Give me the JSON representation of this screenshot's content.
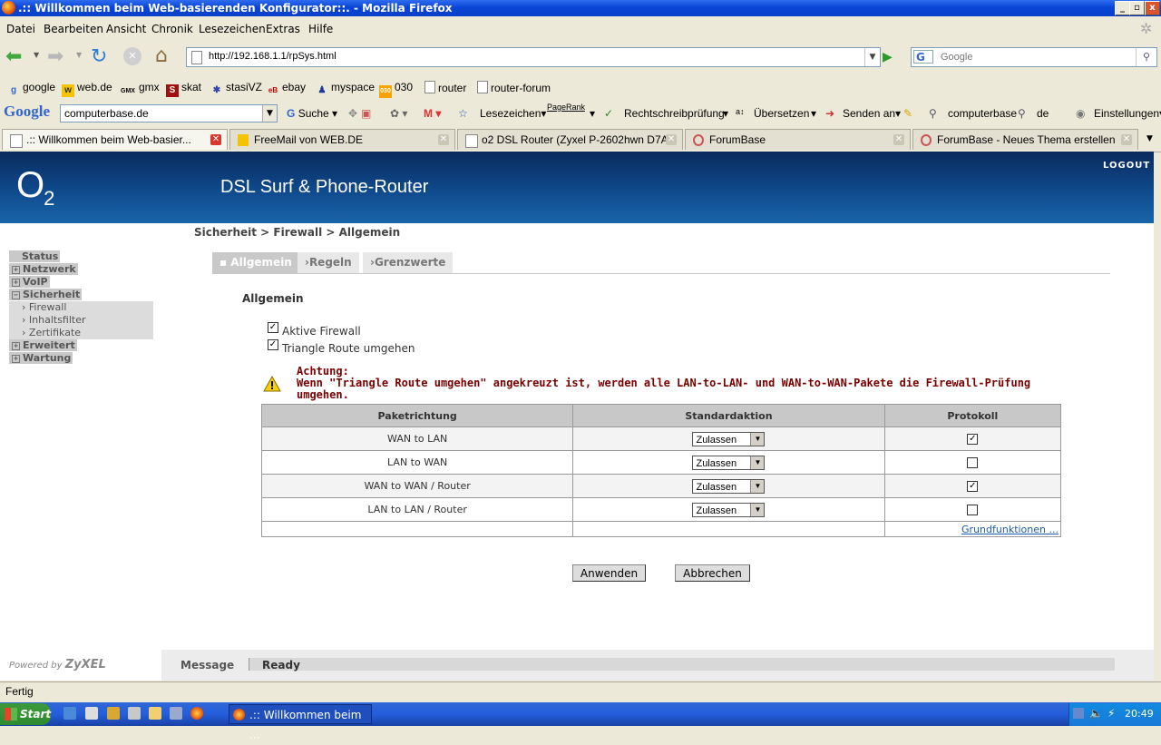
{
  "window": {
    "title": ".:: Willkommen beim Web-basierenden Konfigurator::. - Mozilla Firefox",
    "minimize": "_",
    "maximize": "▫",
    "close": "x"
  },
  "menu": [
    "Datei",
    "Bearbeiten",
    "Ansicht",
    "Chronik",
    "Lesezeichen",
    "Extras",
    "Hilfe"
  ],
  "nav": {
    "url": "http://192.168.1.1/rpSys.html",
    "search_placeholder": "Google"
  },
  "bookmarks": [
    "google",
    "web.de",
    "gmx",
    "skat",
    "stasiVZ",
    "ebay",
    "myspace",
    "030",
    "router",
    "router-forum"
  ],
  "google_toolbar": {
    "logo": "Google",
    "query": "computerbase.de",
    "suche": "Suche",
    "lesezeichen": "Lesezeichen▾",
    "pagerank": "PageRank",
    "spell": "Rechtschreibprüfung",
    "translate": "Übersetzen",
    "send": "Senden an▾",
    "term1": "computerbase",
    "term2": "de",
    "settings": "Einstellungen▾"
  },
  "tabs": [
    {
      "label": ".:: Willkommen beim Web-basier...",
      "active": true
    },
    {
      "label": "FreeMail von WEB.DE",
      "active": false
    },
    {
      "label": "o2 DSL Router (Zyxel P-2602hwn D7A...",
      "active": false
    },
    {
      "label": "ForumBase",
      "active": false
    },
    {
      "label": "ForumBase - Neues Thema erstellen",
      "active": false
    }
  ],
  "router": {
    "logo_main": "O",
    "logo_sub": "2",
    "header_title": "DSL Surf & Phone-Router",
    "logout": "LOGOUT",
    "breadcrumb": "Sicherheit > Firewall > Allgemein",
    "sidebar": {
      "status": "Status",
      "netzwerk": "Netzwerk",
      "voip": "VoIP",
      "sicherheit": "Sicherheit",
      "erweitert": "Erweitert",
      "wartung": "Wartung",
      "sub_firewall": "Firewall",
      "sub_inhaltsfilter": "Inhaltsfilter",
      "sub_zertifikate": "Zertifikate"
    },
    "page_tabs": [
      "▪ Allgemein",
      "›Regeln",
      "›Grenzwerte"
    ],
    "section_title": "Allgemein",
    "options": [
      {
        "label": "Aktive Firewall",
        "checked": true
      },
      {
        "label": "Triangle Route umgehen",
        "checked": true
      }
    ],
    "warning_title": "Achtung:",
    "warning_text": "Wenn \"Triangle Route umgehen\" angekreuzt ist, werden alle LAN-to-LAN- und WAN-to-WAN-Pakete die Firewall-Prüfung umgehen.",
    "table": {
      "headers": [
        "Paketrichtung",
        "Standardaktion",
        "Protokoll"
      ],
      "rows": [
        {
          "direction": "WAN to LAN",
          "action": "Zulassen",
          "log": "✓"
        },
        {
          "direction": "LAN to WAN",
          "action": "Zulassen",
          "log": ""
        },
        {
          "direction": "WAN to WAN / Router",
          "action": "Zulassen",
          "log": "✓"
        },
        {
          "direction": "LAN to LAN / Router",
          "action": "Zulassen",
          "log": ""
        }
      ],
      "link": "Grundfunktionen ..."
    },
    "apply": "Anwenden",
    "cancel": "Abbrechen",
    "powered_by": "Powered by",
    "vendor": "ZyXEL",
    "message_label": "Message",
    "message_value": "Ready"
  },
  "statusbar": "Fertig",
  "taskbar": {
    "start": "Start",
    "window": ".:: Willkommen beim ...",
    "clock": "20:49"
  }
}
